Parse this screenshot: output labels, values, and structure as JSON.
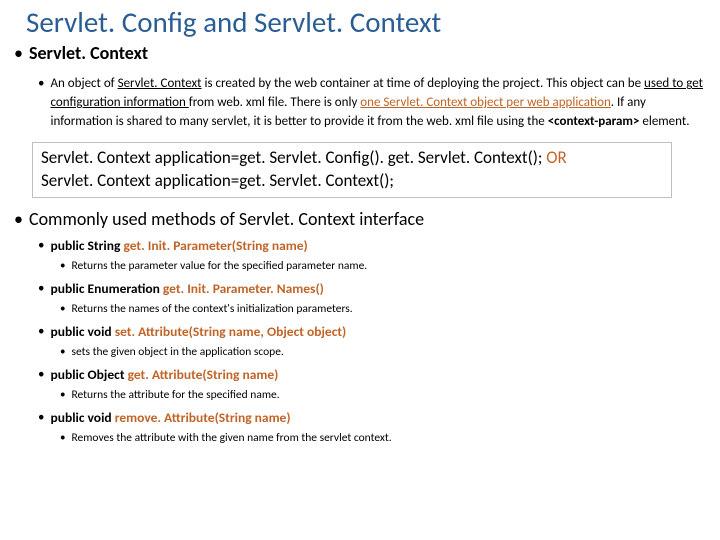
{
  "title": "Servlet. Config and Servlet. Context",
  "heading1": "Servlet. Context",
  "para_a": "An object of ",
  "para_b": "Servlet. Context",
  "para_c": " is created by the web container at time of deploying the project. This object can be ",
  "para_d": "used to get configuration information ",
  "para_e": "from web. xml file. There is only ",
  "para_f": "one Servlet. Context object per web application",
  "para_g": ". If any information is shared to many servlet, it is better to provide it from the web. xml file using the ",
  "para_h": "<context-param>",
  "para_i": " element.",
  "code1a": "Servlet. Context application=get. Servlet. Config(). get. Servlet. Context(); ",
  "code1b": "OR",
  "code2": "Servlet. Context application=get. Servlet. Context();",
  "heading2": "Commonly used methods of Servlet. Context interface",
  "m1_pre": "public String ",
  "m1_name": "get. Init. Parameter(String name)",
  "m1_desc": "Returns the parameter value for the specified parameter name.",
  "m2_pre": "public Enumeration ",
  "m2_name": "get. Init. Parameter. Names()",
  "m2_desc": "Returns the names of the context's initialization parameters.",
  "m3_pre": "public void ",
  "m3_name": "set. Attribute(String name, Object object)",
  "m3_desc": "sets the given object in the application scope.",
  "m4_pre": "public Object ",
  "m4_name": "get. Attribute(String name)",
  "m4_desc": "Returns the attribute for the specified name.",
  "m5_pre": "public void ",
  "m5_name": "remove. Attribute(String name)",
  "m5_desc": "Removes the attribute with the given name from the servlet context."
}
